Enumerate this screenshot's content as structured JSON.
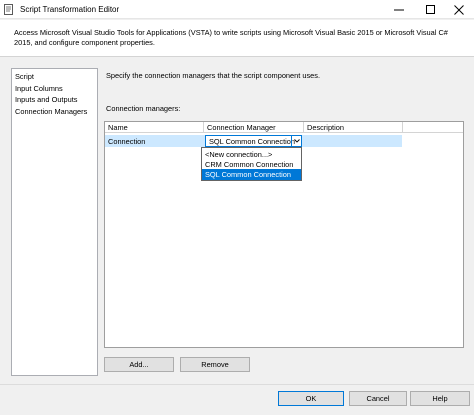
{
  "window": {
    "title": "Script Transformation Editor"
  },
  "header": {
    "description": "Access Microsoft Visual Studio Tools for Applications (VSTA) to write scripts using Microsoft Visual Basic 2015 or Microsoft Visual C# 2015, and configure component properties."
  },
  "nav": {
    "items": [
      "Script",
      "Input Columns",
      "Inputs and Outputs",
      "Connection Managers"
    ]
  },
  "main": {
    "intro": "Specify the connection managers that the script component uses.",
    "grid_label": "Connection managers:",
    "columns": [
      "Name",
      "Connection Manager",
      "Description"
    ],
    "row": {
      "name": "Connection",
      "selected_manager": "SQL Common Connection"
    },
    "dropdown_options": [
      "<New connection...>",
      "CRM Common Connection",
      "SQL Common Connection"
    ]
  },
  "buttons": {
    "add": "Add...",
    "remove": "Remove",
    "ok": "OK",
    "cancel": "Cancel",
    "help": "Help"
  },
  "colors": {
    "selection": "#0078d7",
    "row_highlight": "#cce8ff"
  }
}
